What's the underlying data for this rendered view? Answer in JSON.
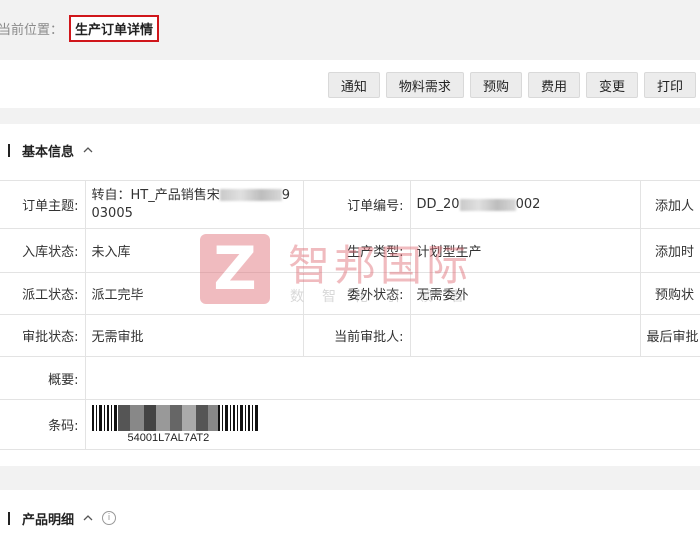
{
  "breadcrumb": {
    "label": "当前位置：",
    "current": "生产订单详情"
  },
  "toolbar": {
    "buttons": [
      "通知",
      "物料需求",
      "预购",
      "费用",
      "变更",
      "打印"
    ]
  },
  "basic_info": {
    "title": "基本信息",
    "rows": {
      "order_subject_label": "订单主题:",
      "order_subject_value_a": "转自：HT_产品销售宋",
      "order_subject_value_b": "9",
      "order_subject_value_c": "03005",
      "order_no_label": "订单编号:",
      "order_no_prefix": "DD_20",
      "order_no_suffix": "002",
      "adder_label": "添加人",
      "stock_status_label": "入库状态:",
      "stock_status_value": "未入库",
      "production_type_label": "生产类型:",
      "production_type_value": "计划型生产",
      "add_time_label": "添加时",
      "dispatch_status_label": "派工状态:",
      "dispatch_status_value": "派工完毕",
      "outsource_status_label": "委外状态:",
      "outsource_status_value": "无需委外",
      "prepurchase_status_label": "预购状",
      "approval_status_label": "审批状态:",
      "approval_status_value": "无需审批",
      "current_approver_label": "当前审批人:",
      "current_approver_value": "",
      "last_approval_label": "最后审批",
      "summary_label": "概要:",
      "summary_value": "",
      "barcode_label": "条码:",
      "barcode_value": "54001L7AL7AT2"
    }
  },
  "watermark": {
    "logo_letter": "Z",
    "title": "智邦国际",
    "subtitle": "数智化引领者",
    "color": "#e06a73"
  },
  "product": {
    "title": "产品明细",
    "info_glyph": "i"
  },
  "colors": {
    "highlight_border": "#d0161b",
    "button_bg": "#ececec",
    "page_bg": "#f2f2f2"
  }
}
